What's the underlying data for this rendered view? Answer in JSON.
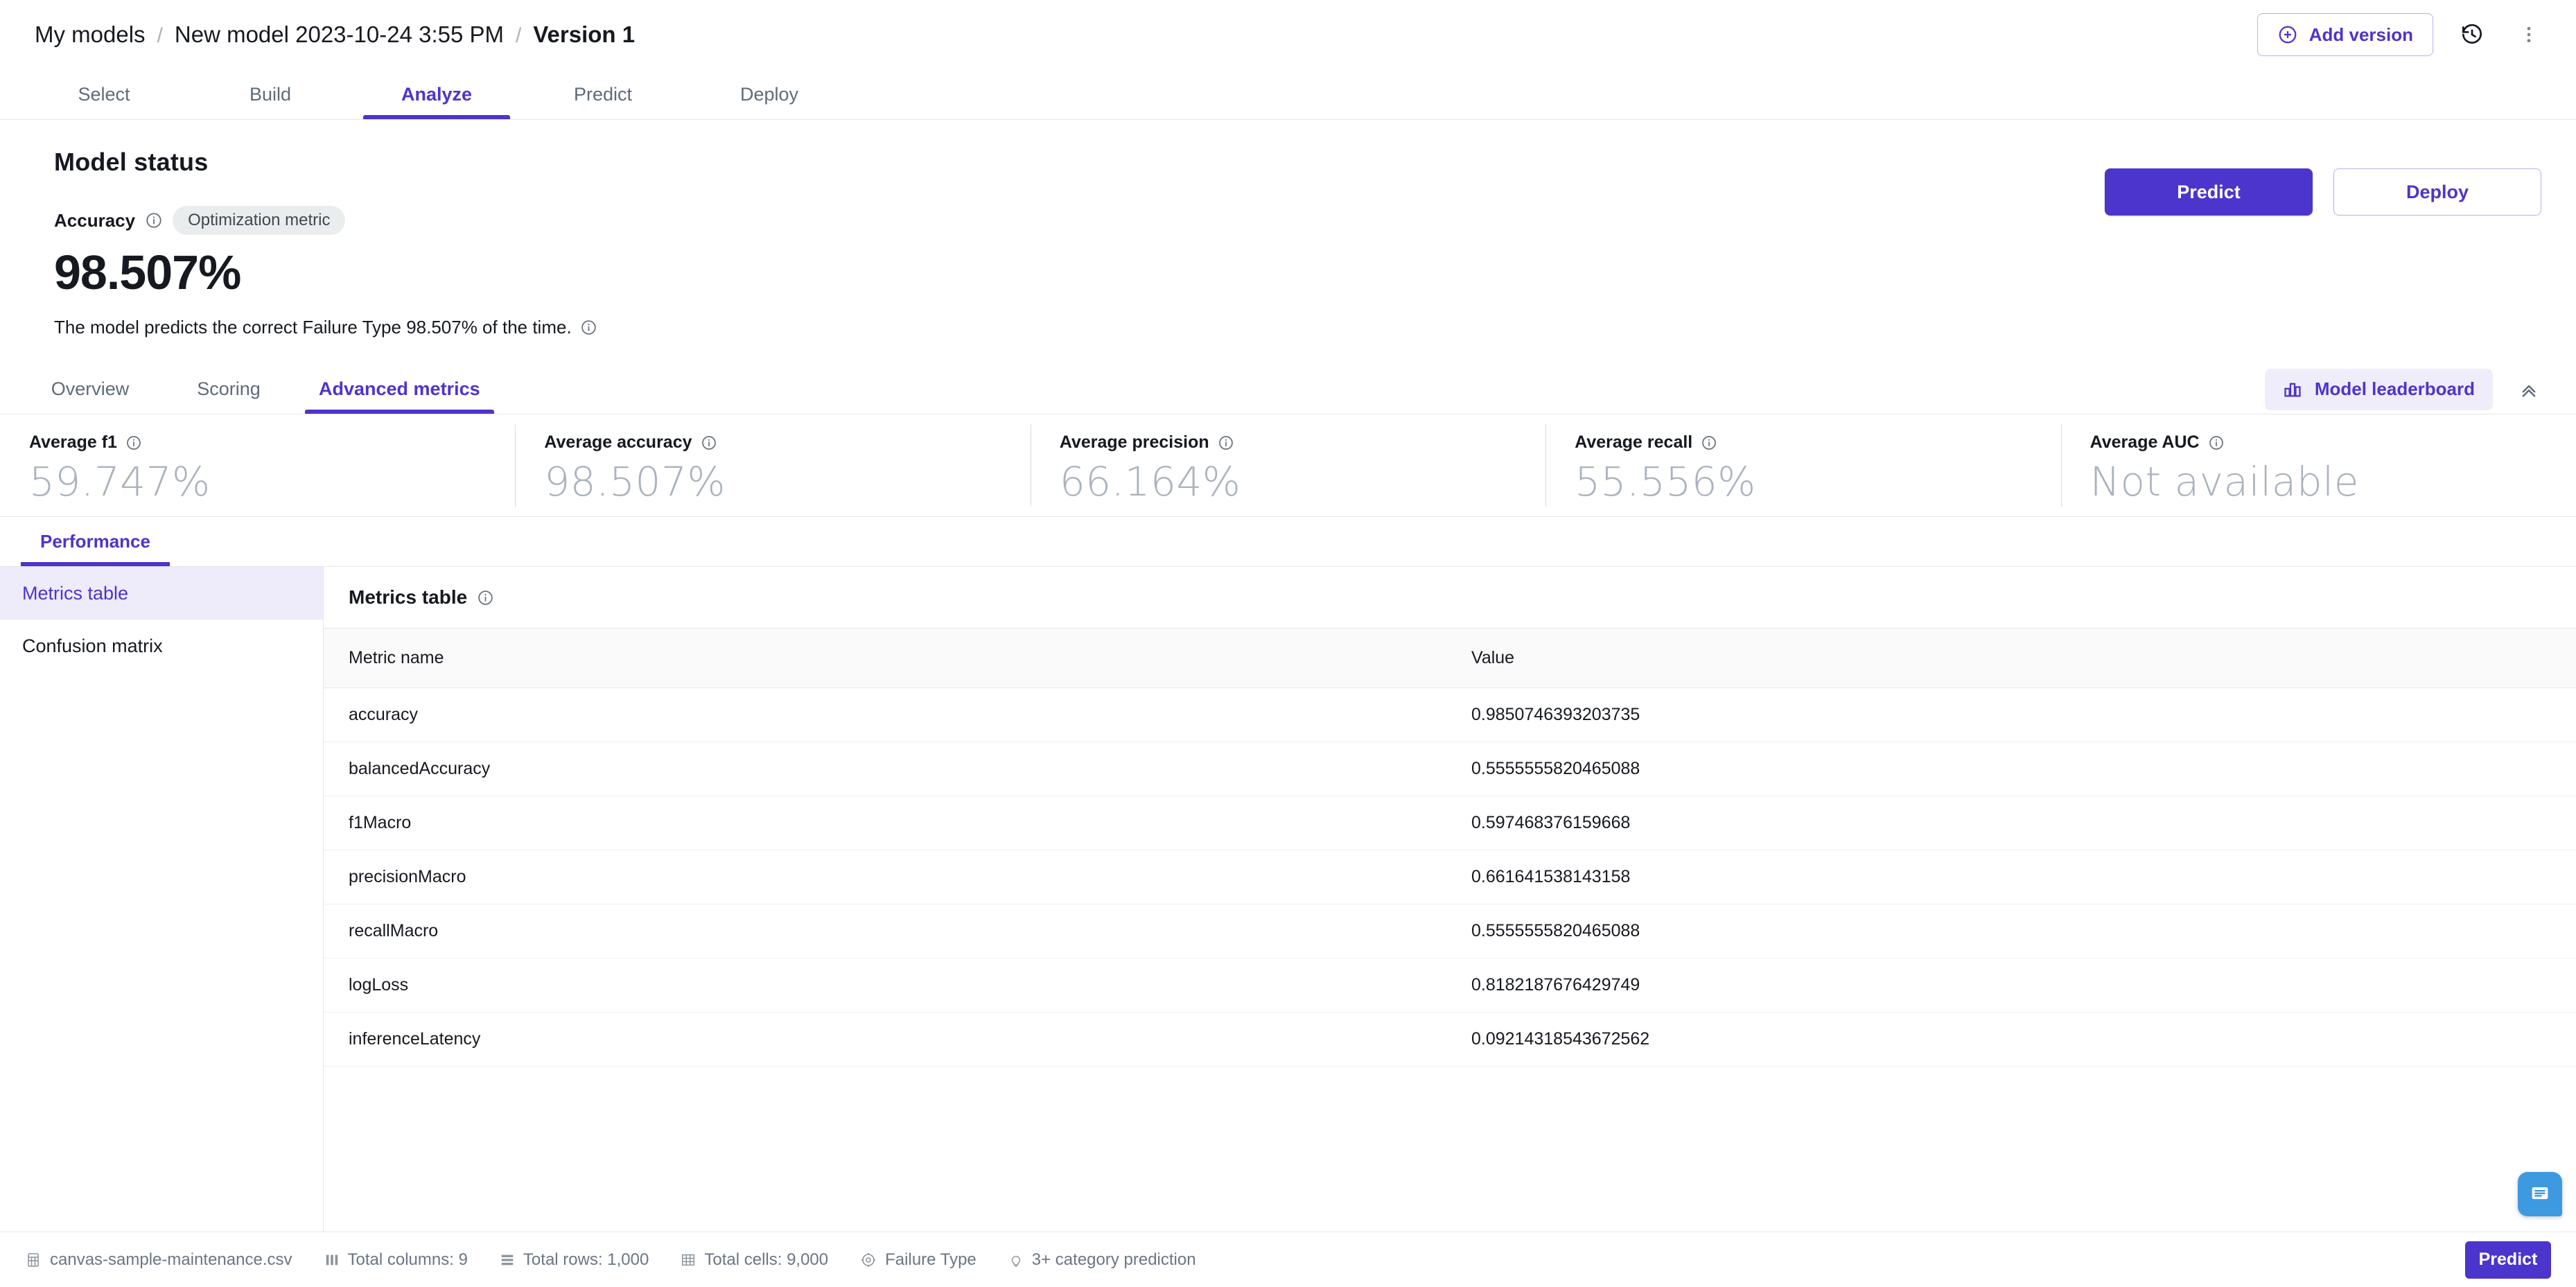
{
  "breadcrumb": {
    "root": "My models",
    "model": "New model 2023-10-24 3:55 PM",
    "version": "Version 1",
    "separator": "/"
  },
  "topbar": {
    "add_version_label": "Add version",
    "history_icon": "history-icon",
    "overflow_icon": "more-vertical-icon"
  },
  "main_tabs": [
    {
      "label": "Select",
      "active": false
    },
    {
      "label": "Build",
      "active": false
    },
    {
      "label": "Analyze",
      "active": true
    },
    {
      "label": "Predict",
      "active": false
    },
    {
      "label": "Deploy",
      "active": false
    }
  ],
  "model_status": {
    "title": "Model status",
    "metric_label": "Accuracy",
    "badge": "Optimization metric",
    "value": "98.507%",
    "description": "The model predicts the correct Failure Type 98.507% of the time.",
    "predict_label": "Predict",
    "deploy_label": "Deploy"
  },
  "sub_tabs": [
    {
      "label": "Overview",
      "active": false
    },
    {
      "label": "Scoring",
      "active": false
    },
    {
      "label": "Advanced metrics",
      "active": true
    }
  ],
  "leaderboard": {
    "label": "Model leaderboard",
    "icon": "bar-chart-icon",
    "collapse_icon": "chevron-double-up-icon"
  },
  "metric_cards": [
    {
      "label": "Average f1",
      "value": "59.747%"
    },
    {
      "label": "Average accuracy",
      "value": "98.507%"
    },
    {
      "label": "Average precision",
      "value": "66.164%"
    },
    {
      "label": "Average recall",
      "value": "55.556%"
    },
    {
      "label": "Average AUC",
      "value": "Not available"
    }
  ],
  "performance_tabs": [
    {
      "label": "Performance",
      "active": true
    }
  ],
  "sidebar": {
    "items": [
      {
        "label": "Metrics table",
        "active": true
      },
      {
        "label": "Confusion matrix",
        "active": false
      }
    ]
  },
  "panel": {
    "title": "Metrics table",
    "columns": [
      "Metric name",
      "Value"
    ],
    "rows": [
      {
        "name": "accuracy",
        "value": "0.9850746393203735"
      },
      {
        "name": "balancedAccuracy",
        "value": "0.5555555820465088"
      },
      {
        "name": "f1Macro",
        "value": "0.597468376159668"
      },
      {
        "name": "precisionMacro",
        "value": "0.661641538143158"
      },
      {
        "name": "recallMacro",
        "value": "0.5555555820465088"
      },
      {
        "name": "logLoss",
        "value": "0.8182187676429749"
      },
      {
        "name": "inferenceLatency",
        "value": "0.09214318543672562"
      }
    ]
  },
  "footer": {
    "items": [
      {
        "label": "canvas-sample-maintenance.csv",
        "icon": "dataset-icon"
      },
      {
        "label": "Total columns: 9",
        "icon": "columns-icon"
      },
      {
        "label": "Total rows: 1,000",
        "icon": "rows-icon"
      },
      {
        "label": "Total cells: 9,000",
        "icon": "cells-icon"
      },
      {
        "label": "Failure Type",
        "icon": "target-icon"
      },
      {
        "label": "3+ category prediction",
        "icon": "bulb-icon"
      }
    ],
    "predict_label": "Predict"
  },
  "colors": {
    "accent": "#4b35cc",
    "accent_soft": "#f0edfb",
    "sidebar_selected": "#eeebfa",
    "chat": "#3d9ae0",
    "muted_value": "#aab2bd",
    "border": "#e4e6ea"
  }
}
